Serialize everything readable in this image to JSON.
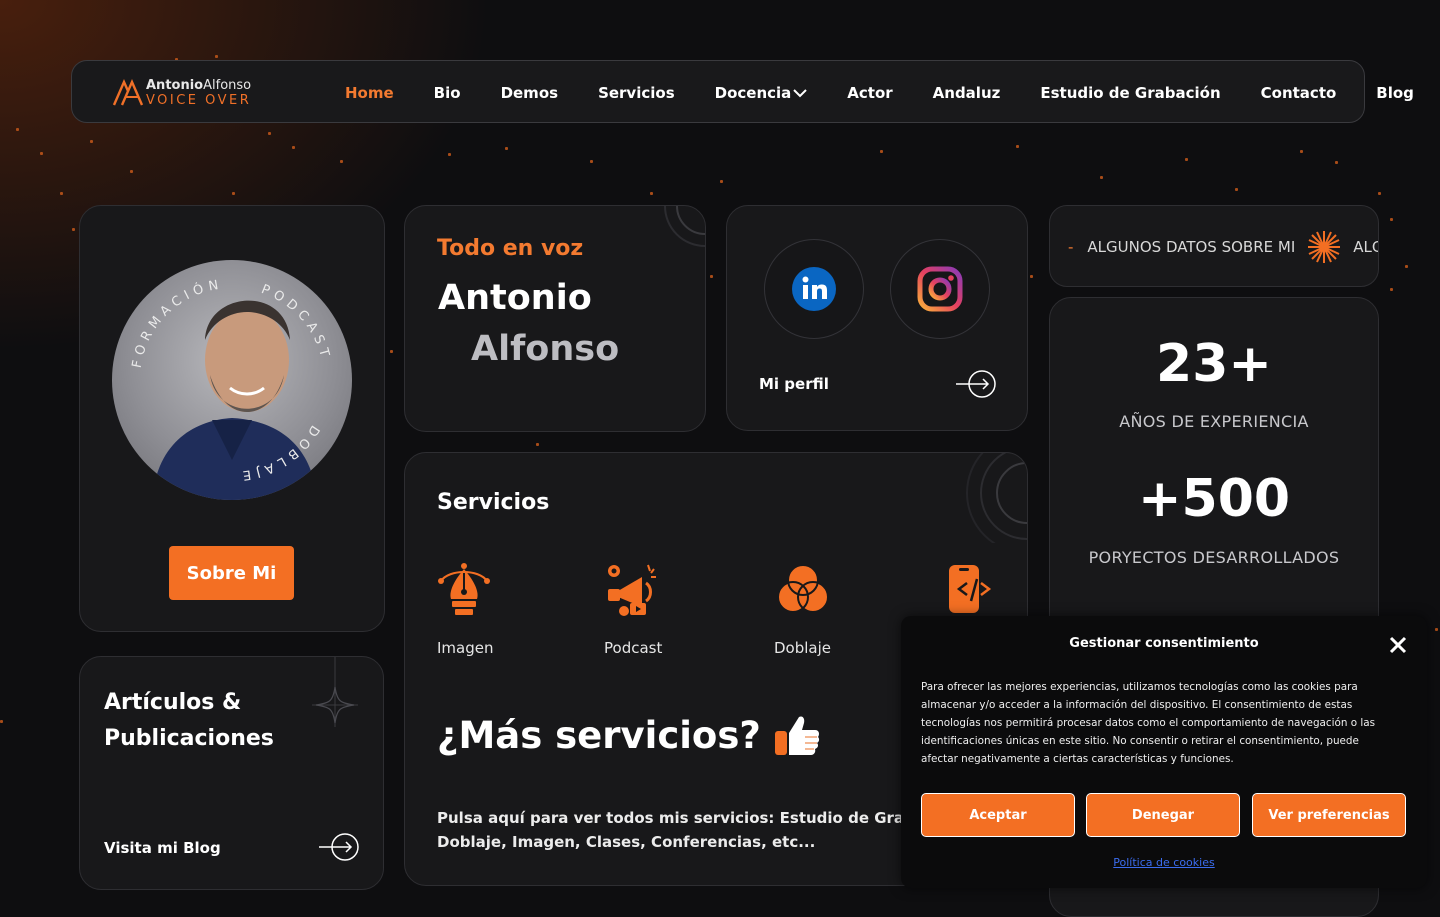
{
  "colors": {
    "accent": "#f36f23",
    "background": "#0e0e10",
    "card": "#18181a",
    "link": "#3b6df0"
  },
  "logo": {
    "first_bold": "Antonio",
    "first_light": "Alfonso",
    "tagline": "VOICE OVER"
  },
  "nav": {
    "items": [
      {
        "label": "Home",
        "active": true
      },
      {
        "label": "Bio"
      },
      {
        "label": "Demos"
      },
      {
        "label": "Servicios"
      },
      {
        "label": "Docencia",
        "has_dropdown": true
      },
      {
        "label": "Actor"
      },
      {
        "label": "Andaluz"
      },
      {
        "label": "Estudio de Grabación"
      },
      {
        "label": "Contacto"
      },
      {
        "label": "Blog"
      }
    ]
  },
  "profile": {
    "ring_top": "FORMACIÓN",
    "ring_right": "PODCAST",
    "ring_bottom": "DOBLAJE",
    "button": "Sobre Mi"
  },
  "intro": {
    "kicker": "Todo en voz",
    "name_first": "Antonio",
    "name_last": "Alfonso"
  },
  "social": {
    "linkedin_icon": "linkedin-icon",
    "instagram_icon": "instagram-icon",
    "label": "Mi perfil"
  },
  "services": {
    "title": "Servicios",
    "items": [
      {
        "label": "Imagen",
        "icon": "pen-nib-icon"
      },
      {
        "label": "Podcast",
        "icon": "megaphone-icon"
      },
      {
        "label": "Doblaje",
        "icon": "venn-circles-icon"
      },
      {
        "label": "",
        "icon": "mobile-code-icon"
      }
    ],
    "more_heading": "¿Más servicios?",
    "more_text_line1": "Pulsa aquí para ver todos mis servicios: Estudio de Grabación, Po",
    "more_text_line2": "Doblaje, Imagen, Clases, Conferencias, etc..."
  },
  "articles": {
    "title_line1": "Artículos &",
    "title_line2": "Publicaciones",
    "link": "Visita mi Blog"
  },
  "ticker": {
    "text1": "ALGUNOS DATOS SOBRE MI",
    "text2": "ALG"
  },
  "stats": [
    {
      "value": "23+",
      "label": "AÑOS DE EXPERIENCIA"
    },
    {
      "value": "+500",
      "label": "PORYECTOS DESARROLLADOS"
    }
  ],
  "consent": {
    "title": "Gestionar consentimiento",
    "text": "Para ofrecer las mejores experiencias, utilizamos tecnologías como las cookies para almacenar y/o acceder a la información del dispositivo. El consentimiento de estas tecnologías nos permitirá procesar datos como el comportamiento de navegación o las identificaciones únicas en este sitio. No consentir o retirar el consentimiento, puede afectar negativamente a ciertas características y funciones.",
    "accept": "Aceptar",
    "deny": "Denegar",
    "preferences": "Ver preferencias",
    "policy_link": "Política de cookies"
  }
}
